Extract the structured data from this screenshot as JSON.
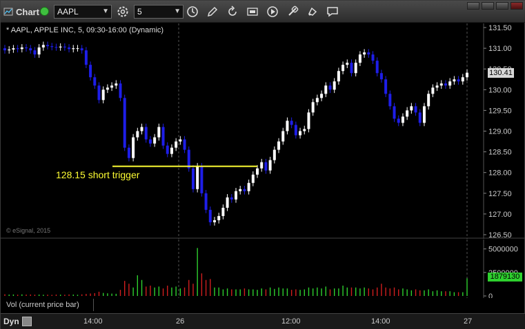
{
  "toolbar": {
    "title": "Chart",
    "symbol": "AAPL",
    "interval": "5",
    "icons": [
      "dropdown-caret",
      "settings-icon",
      "clock-icon",
      "pencil-icon",
      "refresh-icon",
      "gif-icon",
      "play-icon",
      "link-icon",
      "comment-icon"
    ]
  },
  "chart": {
    "study_title": "* AAPL, APPLE INC, 5, 09:30-16:00 (Dynamic)",
    "copyright": "© eSignal, 2015",
    "annotation": "128.15 short trigger",
    "trigger_level": 128.15,
    "last_price": "130.41",
    "price_axis_ticks": [
      "131.50",
      "131.00",
      "130.50",
      "130.00",
      "129.50",
      "129.00",
      "128.50",
      "128.00",
      "127.50",
      "127.00",
      "126.50"
    ],
    "volume_axis_ticks": [
      "5000000",
      "2500000",
      "0"
    ],
    "volume_last": "1879130",
    "volume_label": "Vol (current price bar)",
    "time_labels": [
      "14:00",
      "26",
      "12:00",
      "14:00",
      "27"
    ],
    "colors": {
      "up": "#ffffff",
      "down": "#1e1ee8",
      "trigger": "#ffff33",
      "vol_up": "#2ed02e",
      "vol_down": "#d01e1e"
    }
  },
  "chart_data": {
    "type": "candlestick",
    "price_range": [
      126.4,
      131.6
    ],
    "volume_range": [
      0,
      6000000
    ],
    "closes": [
      130.95,
      130.97,
      131.0,
      130.98,
      131.02,
      131.0,
      130.95,
      130.85,
      131.02,
      131.08,
      131.05,
      131.03,
      131.02,
      131.04,
      131.02,
      130.98,
      131.0,
      131.0,
      130.95,
      130.6,
      130.3,
      130.1,
      129.75,
      130.0,
      130.05,
      130.1,
      130.15,
      129.8,
      128.6,
      128.35,
      128.85,
      129.0,
      129.1,
      128.8,
      128.7,
      128.85,
      129.1,
      128.65,
      128.45,
      128.6,
      128.75,
      128.8,
      128.55,
      128.1,
      127.6,
      128.15,
      127.5,
      127.1,
      126.8,
      126.85,
      126.95,
      127.15,
      127.4,
      127.35,
      127.55,
      127.6,
      127.55,
      127.75,
      127.95,
      128.1,
      128.25,
      128.05,
      128.3,
      128.55,
      128.75,
      129.0,
      129.25,
      129.15,
      128.9,
      129.0,
      129.05,
      129.45,
      129.7,
      129.8,
      129.9,
      130.1,
      130.0,
      130.2,
      130.45,
      130.6,
      130.65,
      130.4,
      130.65,
      130.85,
      130.9,
      130.85,
      130.7,
      130.4,
      130.25,
      129.9,
      129.6,
      129.3,
      129.2,
      129.35,
      129.5,
      129.6,
      129.45,
      129.2,
      129.6,
      129.9,
      130.05,
      130.1,
      130.15,
      130.1,
      130.2,
      130.25,
      130.2,
      130.3,
      130.41
    ],
    "volumes": [
      180000,
      150000,
      160000,
      140000,
      170000,
      150000,
      160000,
      140000,
      150000,
      130000,
      140000,
      120000,
      150000,
      140000,
      130000,
      160000,
      150000,
      130000,
      170000,
      220000,
      260000,
      300000,
      450000,
      320000,
      280000,
      250000,
      230000,
      650000,
      1600000,
      1300000,
      900000,
      2200000,
      1700000,
      1000000,
      1100000,
      900000,
      1000000,
      800000,
      1100000,
      900000,
      1000000,
      800000,
      900000,
      1700000,
      1300000,
      5100000,
      2400000,
      1700000,
      1800000,
      900000,
      900000,
      700000,
      800000,
      700000,
      700000,
      700000,
      800000,
      700000,
      700000,
      650000,
      800000,
      700000,
      900000,
      750000,
      900000,
      800000,
      800000,
      650000,
      700000,
      650000,
      700000,
      900000,
      800000,
      900000,
      800000,
      1000000,
      700000,
      800000,
      800000,
      1100000,
      900000,
      900000,
      900000,
      800000,
      900000,
      800000,
      700000,
      900000,
      1300000,
      900000,
      800000,
      900000,
      700000,
      800000,
      700000,
      600000,
      700000,
      600000,
      600000,
      700000,
      500000,
      600000,
      500000,
      500000,
      500000,
      400000,
      400000,
      400000,
      1879130
    ]
  }
}
